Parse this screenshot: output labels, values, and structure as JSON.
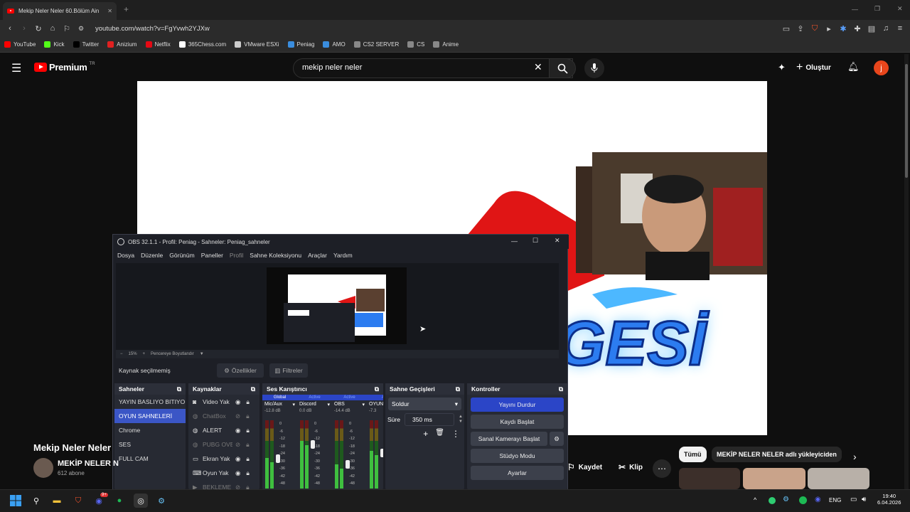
{
  "browser": {
    "tab_title": "Mekip Neler Neler 60.Bölüm Ain",
    "url": "youtube.com/watch?v=FgYvwh2YJXw",
    "bookmarks": [
      {
        "label": "YouTube",
        "color": "#ff0000"
      },
      {
        "label": "Kick",
        "color": "#53fc18"
      },
      {
        "label": "Twitter",
        "color": "#000000"
      },
      {
        "label": "Anizium",
        "color": "#e02020"
      },
      {
        "label": "Netflix",
        "color": "#e50914"
      },
      {
        "label": "365Chess.com",
        "color": "#ffffff"
      },
      {
        "label": "VMware ESXi",
        "color": "#cccccc"
      },
      {
        "label": "Peniag",
        "color": "#3a8dde"
      },
      {
        "label": "AMO",
        "color": "#3a8dde"
      },
      {
        "label": "CS2 SERVER",
        "color": "#888888"
      },
      {
        "label": "CS",
        "color": "#888888"
      },
      {
        "label": "Anime",
        "color": "#888888"
      }
    ]
  },
  "youtube": {
    "logo_text": "Premium",
    "logo_badge": "TR",
    "search_value": "mekip neler neler",
    "create_label": "Oluştur",
    "avatar_letter": "j",
    "video_title": "Mekip Neler Neler",
    "channel_name": "MEKİP NELER N",
    "subscribers": "612 abone",
    "save_label": "Kaydet",
    "clip_label": "Klip",
    "chip_all": "Tümü",
    "chip_uploader": "MEKİP NELER NELER adlı yükleyiciden",
    "overlay_text": "GESİ"
  },
  "obs": {
    "title": "OBS 32.1.1 - Profil: Peniag - Sahneler: Peniag_sahneler",
    "menu": [
      "Dosya",
      "Düzenle",
      "Görünüm",
      "Paneller",
      "Profil",
      "Sahne Koleksiyonu",
      "Araçlar",
      "Yardım"
    ],
    "zoom_label": "15%",
    "fit_label": "Pencereye Boyutlandır",
    "no_source": "Kaynak seçilmemiş",
    "properties": "Özellikler",
    "filters": "Filtreler",
    "scenes_title": "Sahneler",
    "scenes": [
      "YAYIN BASLIYO BITIYO",
      "OYUN SAHNELERİ",
      "Chrome",
      "SES",
      "FULL CAM"
    ],
    "sources_title": "Kaynaklar",
    "sources": [
      "Video Yak",
      "ChatBox",
      "ALERT",
      "PUBG OVE",
      "Ekran Yak",
      "Oyun Yak",
      "BEKLEME"
    ],
    "mixer_title": "Ses Karıştırıcı",
    "mixer_channels": [
      {
        "tag": "Global",
        "name": "Mic/Aux",
        "db": "-12.8 dB"
      },
      {
        "tag": "Active",
        "name": "Discord",
        "db": "0.0 dB"
      },
      {
        "tag": "Active",
        "name": "OBS",
        "db": "-14.4 dB"
      },
      {
        "tag": "Ac",
        "name": "OYUN",
        "db": "-7.3"
      }
    ],
    "meter_ticks": [
      "0",
      "-6",
      "-12",
      "-18",
      "-24",
      "-30",
      "-36",
      "-42",
      "-48"
    ],
    "transitions_title": "Sahne Geçişleri",
    "transition_value": "Soldur",
    "duration_label": "Süre",
    "duration_value": "350 ms",
    "controls_title": "Kontroller",
    "controls": [
      "Yayını Durdur",
      "Kaydı Başlat",
      "Sanal Kamerayı Başlat",
      "Stüdyo Modu",
      "Ayarlar"
    ]
  },
  "taskbar": {
    "lang": "ENG",
    "time": "19:40",
    "date": "6.04.2026",
    "discord_badge": "9+"
  }
}
